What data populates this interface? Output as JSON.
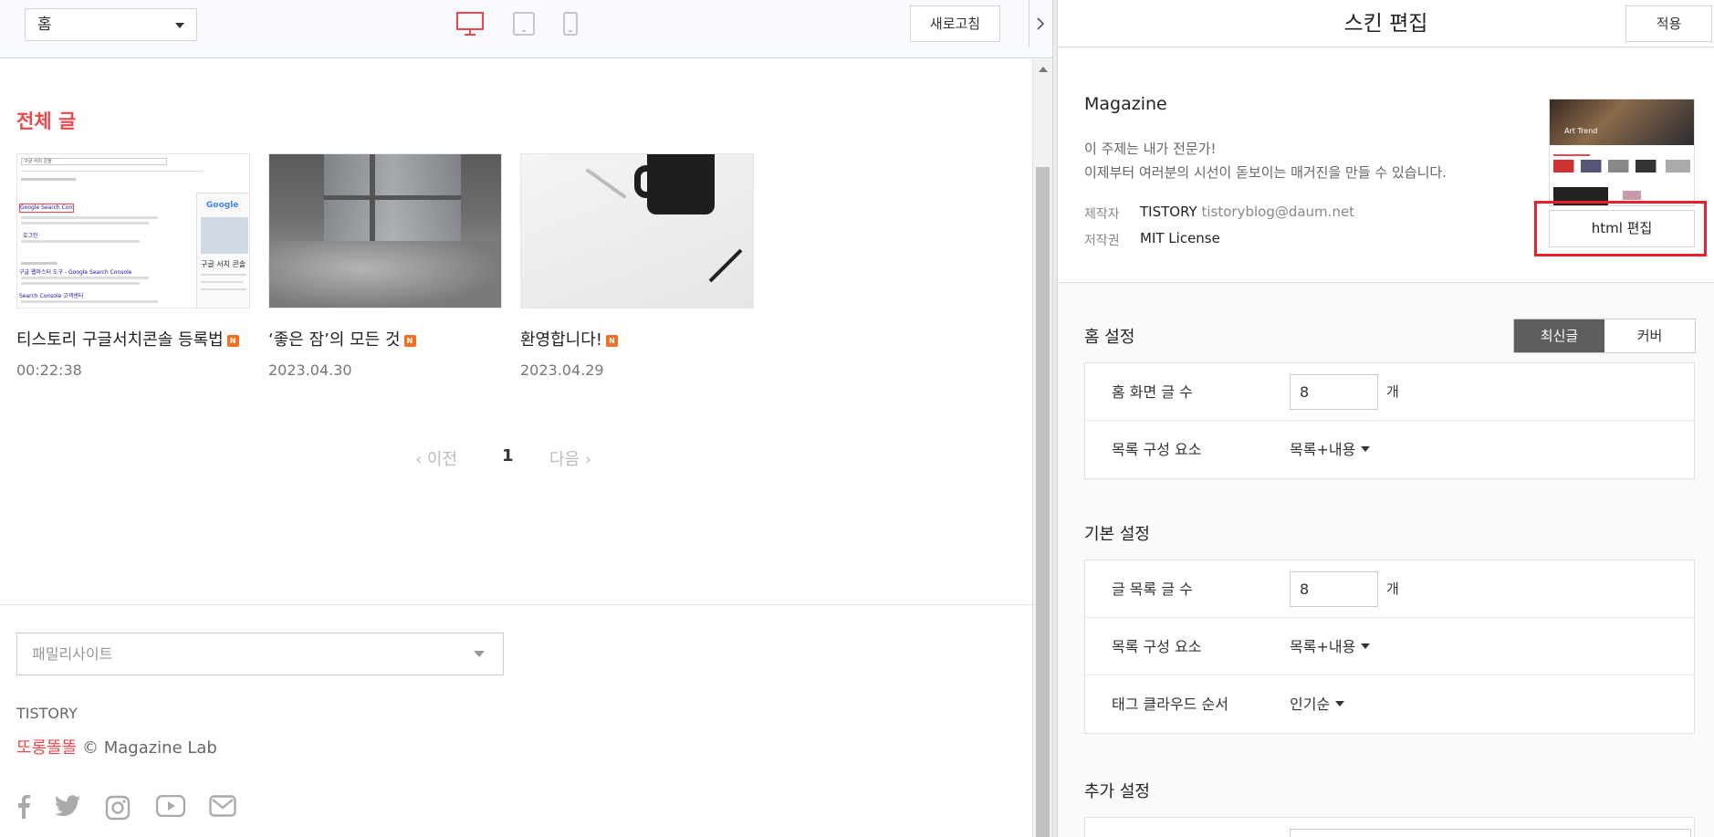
{
  "toolbar": {
    "page_select": "홈",
    "refresh_label": "새로고침",
    "active_color": "#e9494e"
  },
  "blog": {
    "section_title": "전체 글",
    "posts": [
      {
        "title": "티스토리 구글서치콘솔 등록법",
        "badge": "N",
        "date": "00:22:38"
      },
      {
        "title": "‘좋은 잠’의 모든 것",
        "badge": "N",
        "date": "2023.04.30"
      },
      {
        "title": "환영합니다!",
        "badge": "N",
        "date": "2023.04.29"
      }
    ],
    "thumb1": {
      "search_query": "구글 서치 콘솔",
      "result_link_1": "Google Search Console",
      "heading_2": "호그인",
      "result_link_2": "구글 웹마스터 도구 - Google Search Console",
      "result_link_3": "Search Console 고객센터",
      "panel_logo": "Google",
      "panel_title": "구글 서치 콘솔"
    },
    "pagination": {
      "prev": "이전",
      "current": "1",
      "next": "다음"
    },
    "footer": {
      "family_site_placeholder": "패밀리사이트",
      "brand": "TISTORY",
      "nickname": "또롱똘똘",
      "copyright": "© Magazine Lab"
    },
    "social_icons": [
      "facebook-icon",
      "twitter-icon",
      "instagram-icon",
      "youtube-icon",
      "mail-icon"
    ]
  },
  "panel": {
    "title": "스킨 편집",
    "apply_label": "적용",
    "skin": {
      "name": "Magazine",
      "desc_line1": "이 주제는 내가 전문가!",
      "desc_line2": "이제부터 여러분의 시선이 돋보이는 매거진을 만들 수 있습니다.",
      "author_label": "제작자",
      "author": "TISTORY",
      "author_email": "tistoryblog@daum.net",
      "license_label": "저작권",
      "license": "MIT License",
      "thumb_caption": "Art Trend",
      "html_edit_label": "html 편집",
      "highlight_color": "#e8202a"
    },
    "home_settings": {
      "title": "홈 설정",
      "toggle_on": "최신글",
      "toggle_off": "커버",
      "rows": [
        {
          "label": "홈 화면 글 수",
          "value": "8",
          "unit": "개"
        },
        {
          "label": "목록 구성 요소",
          "value": "목록+내용"
        }
      ]
    },
    "basic_settings": {
      "title": "기본 설정",
      "rows": [
        {
          "label": "글 목록 글 수",
          "value": "8",
          "unit": "개"
        },
        {
          "label": "목록 구성 요소",
          "value": "목록+내용"
        },
        {
          "label": "태그 클라우드 순서",
          "value": "인기순"
        }
      ]
    },
    "extra_settings": {
      "title": "추가 설정"
    }
  }
}
